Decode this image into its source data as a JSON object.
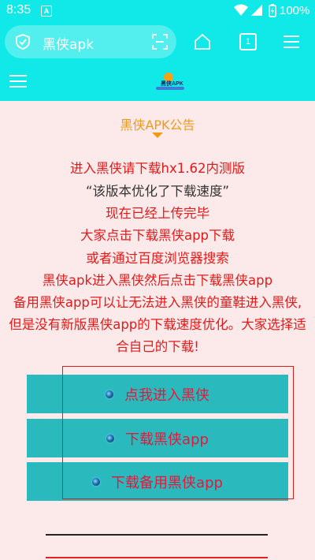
{
  "status": {
    "time": "8:35",
    "notif_glyph": "A",
    "battery": "100%"
  },
  "browser": {
    "title": "黑侠apk",
    "tab_count": "1"
  },
  "site": {
    "logo_text": "黑侠APK"
  },
  "notice": "黑侠APK公告",
  "lines": [
    "进入黑侠请下载hx1.62内测版",
    "“该版本优化了下载速度”",
    "现在已经上传完毕",
    "大家点击下载黑侠app下载",
    "或者通过百度浏览器搜索",
    "黑侠apk进入黑侠然后点击下载黑侠app"
  ],
  "paragraph": "备用黑侠app可以让无法进入黑侠的童鞋进入黑侠,但是没有新版黑侠app的下载速度优化。大家选择适合自己的下载!",
  "buttons": [
    "点我进入黑侠",
    "下载黑侠app",
    "下载备用黑侠app"
  ],
  "colors": {
    "accent": "#11e8e8",
    "text_red": "#e41a1a",
    "notice_orange": "#f19a19",
    "button_bg": "#2ab9bd",
    "page_bg": "#fce9e9"
  }
}
